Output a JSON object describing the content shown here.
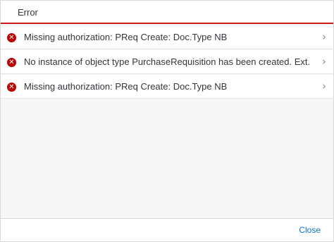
{
  "dialog": {
    "title": "Error",
    "close_label": "Close"
  },
  "messages": [
    {
      "icon": "error-icon",
      "text": "Missing authorization: PReq Create: Doc.Type NB"
    },
    {
      "icon": "error-icon",
      "text": "No instance of object type PurchaseRequisition has been created. Ext..."
    },
    {
      "icon": "error-icon",
      "text": "Missing authorization: PReq Create: Doc.Type NB"
    }
  ],
  "colors": {
    "error": "#bb0000",
    "header_underline": "#cc1919",
    "link": "#0a6ed1"
  }
}
